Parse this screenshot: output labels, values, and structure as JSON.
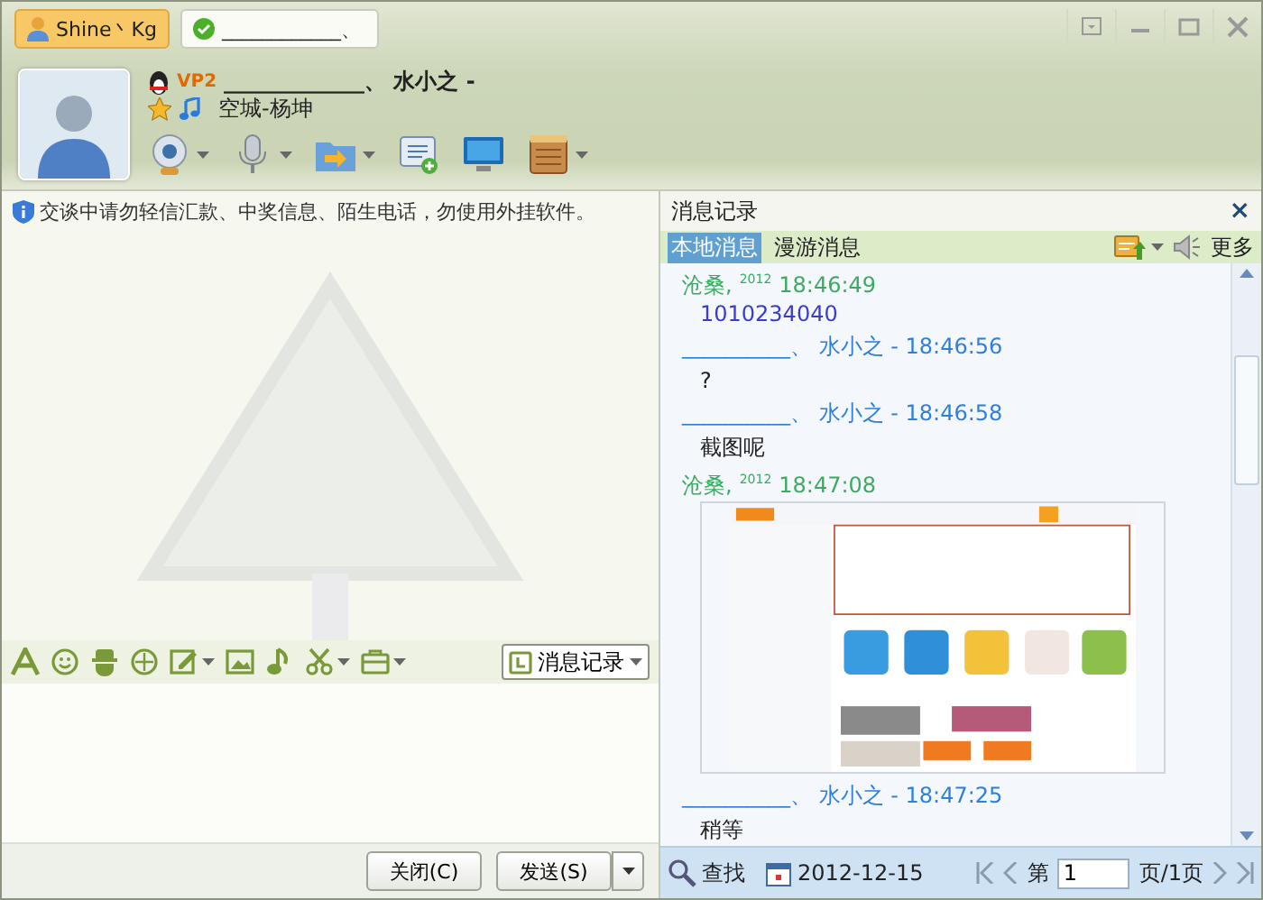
{
  "window": {
    "tabs": [
      {
        "label": "Shine丶Kg",
        "kind": "user",
        "selected": true
      },
      {
        "label": "____________、",
        "kind": "online",
        "selected": false
      }
    ]
  },
  "contact": {
    "vip": "VP2",
    "name": "_____________、 水小之 -",
    "signature": "空城-杨坤"
  },
  "notice": "交谈中请勿轻信汇款、中奖信息、陌生电话，勿使用外挂软件。",
  "input_toolbar": {
    "history_button": "消息记录"
  },
  "buttons": [
    {
      "label": "关闭(C)",
      "dropdown": false
    },
    {
      "label": "发送(S)",
      "dropdown": true
    }
  ],
  "history": {
    "title": "消息记录",
    "close": "×",
    "tabs": [
      {
        "label": "本地消息",
        "selected": true
      },
      {
        "label": "漫游消息",
        "selected": false
      }
    ],
    "more": "更多",
    "messages": [
      {
        "kind": "in",
        "sender": "沧桑,",
        "date": "2012",
        "time": "18:46:49",
        "content": {
          "kind": "number",
          "text": "1010234040"
        }
      },
      {
        "kind": "out",
        "header": "__________、 水小之 - 18:46:56",
        "content": {
          "kind": "text",
          "text": "?"
        }
      },
      {
        "kind": "out",
        "header": "__________、 水小之 - 18:46:58",
        "content": {
          "kind": "text",
          "text": "截图呢"
        }
      },
      {
        "kind": "in",
        "sender": "沧桑,",
        "date": "2012",
        "time": "18:47:08"
      },
      {
        "kind": "out",
        "header": "__________、 水小之 - 18:47:25",
        "content": {
          "kind": "text",
          "text": "稍等"
        }
      }
    ],
    "footer": {
      "search": "查找",
      "date": "2012-12-15",
      "page_label": "第",
      "page": "1",
      "page_total": "页/1页"
    }
  }
}
